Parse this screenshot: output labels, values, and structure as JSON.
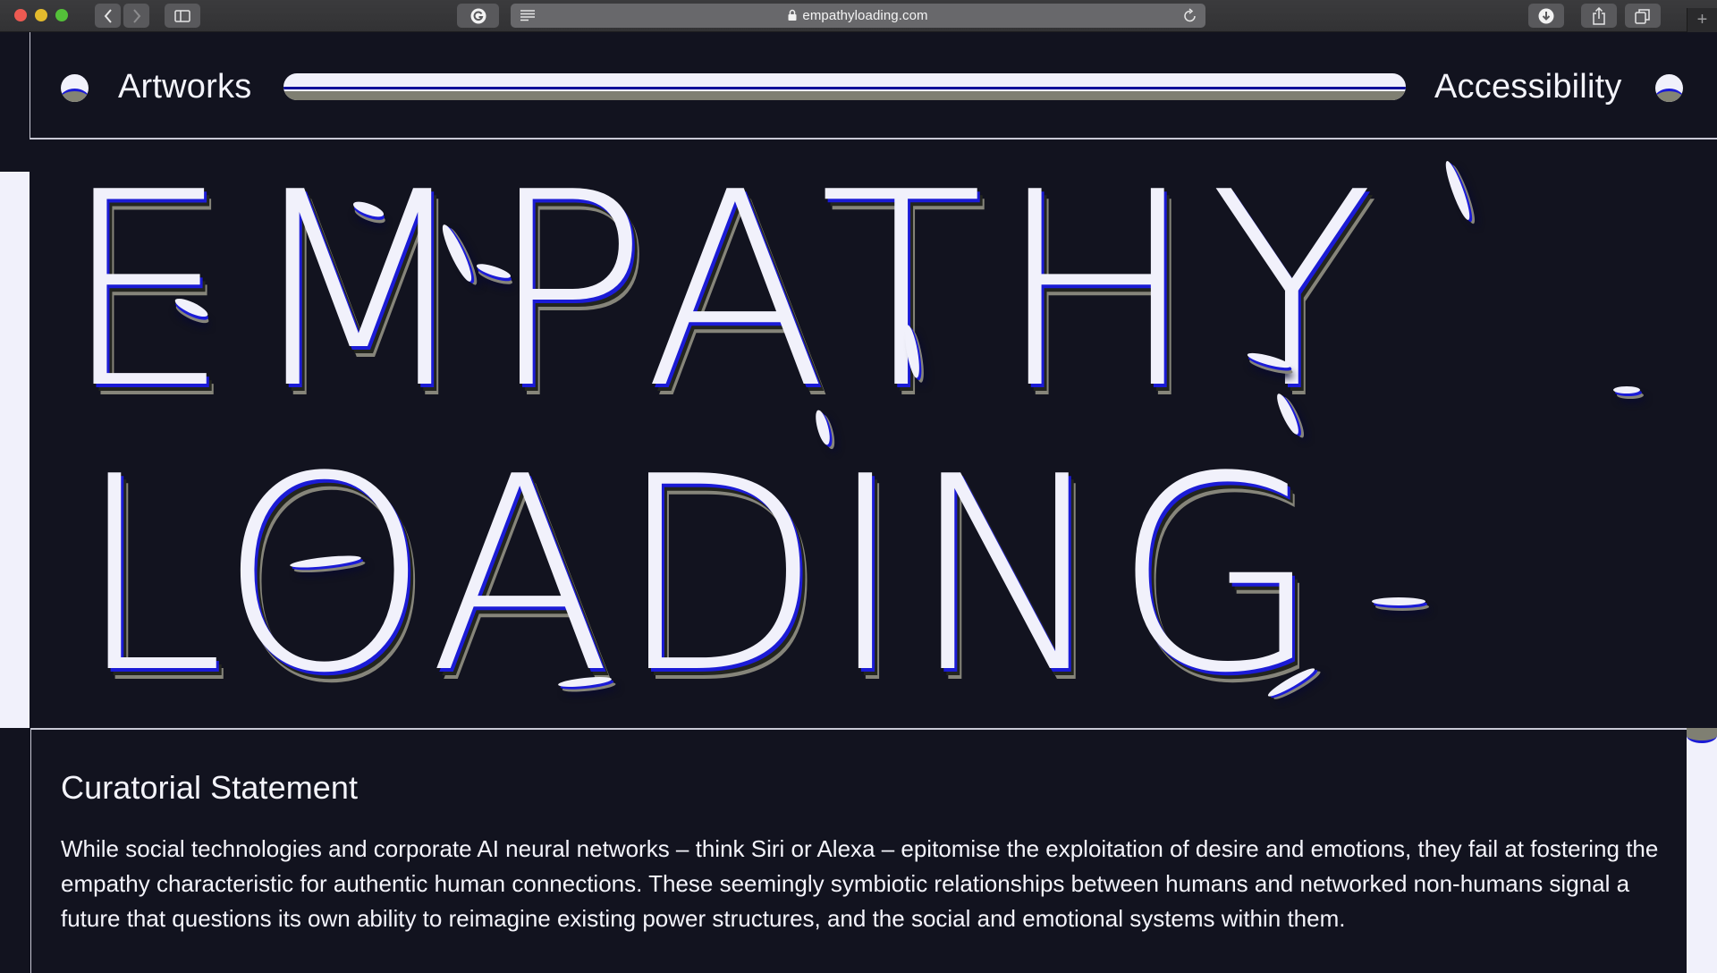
{
  "browser": {
    "url": "empathyloading.com",
    "icons": {
      "back": "chevron-left-icon",
      "forward": "chevron-right-icon",
      "sidebar": "sidebar-icon",
      "extension": "grammarly-g-icon",
      "reader": "reader-lines-icon",
      "lock": "lock-icon",
      "reload": "reload-icon",
      "download": "download-icon",
      "share": "share-icon",
      "tabs": "tabs-overview-icon",
      "new_tab": "+"
    }
  },
  "nav": {
    "left_link": "Artworks",
    "right_link": "Accessibility"
  },
  "hero": {
    "line1": "EMPATHY",
    "line2": "LOADING"
  },
  "statement": {
    "heading": "Curatorial Statement",
    "body": "While social technologies and corporate AI neural networks – think Siri or Alexa – epitomise the exploitation of desire and emotions, they fail at fostering the empathy characteristic for authentic human connections. These seemingly symbiotic relationships between humans and networked non-humans signal a future that questions its own ability to reimagine existing power structures, and the social and emotional systems within them."
  },
  "colors": {
    "background": "#12131f",
    "foreground": "#f1f1fb",
    "accent_blue": "#1b1bd6",
    "shadow_grey": "#86857a"
  }
}
